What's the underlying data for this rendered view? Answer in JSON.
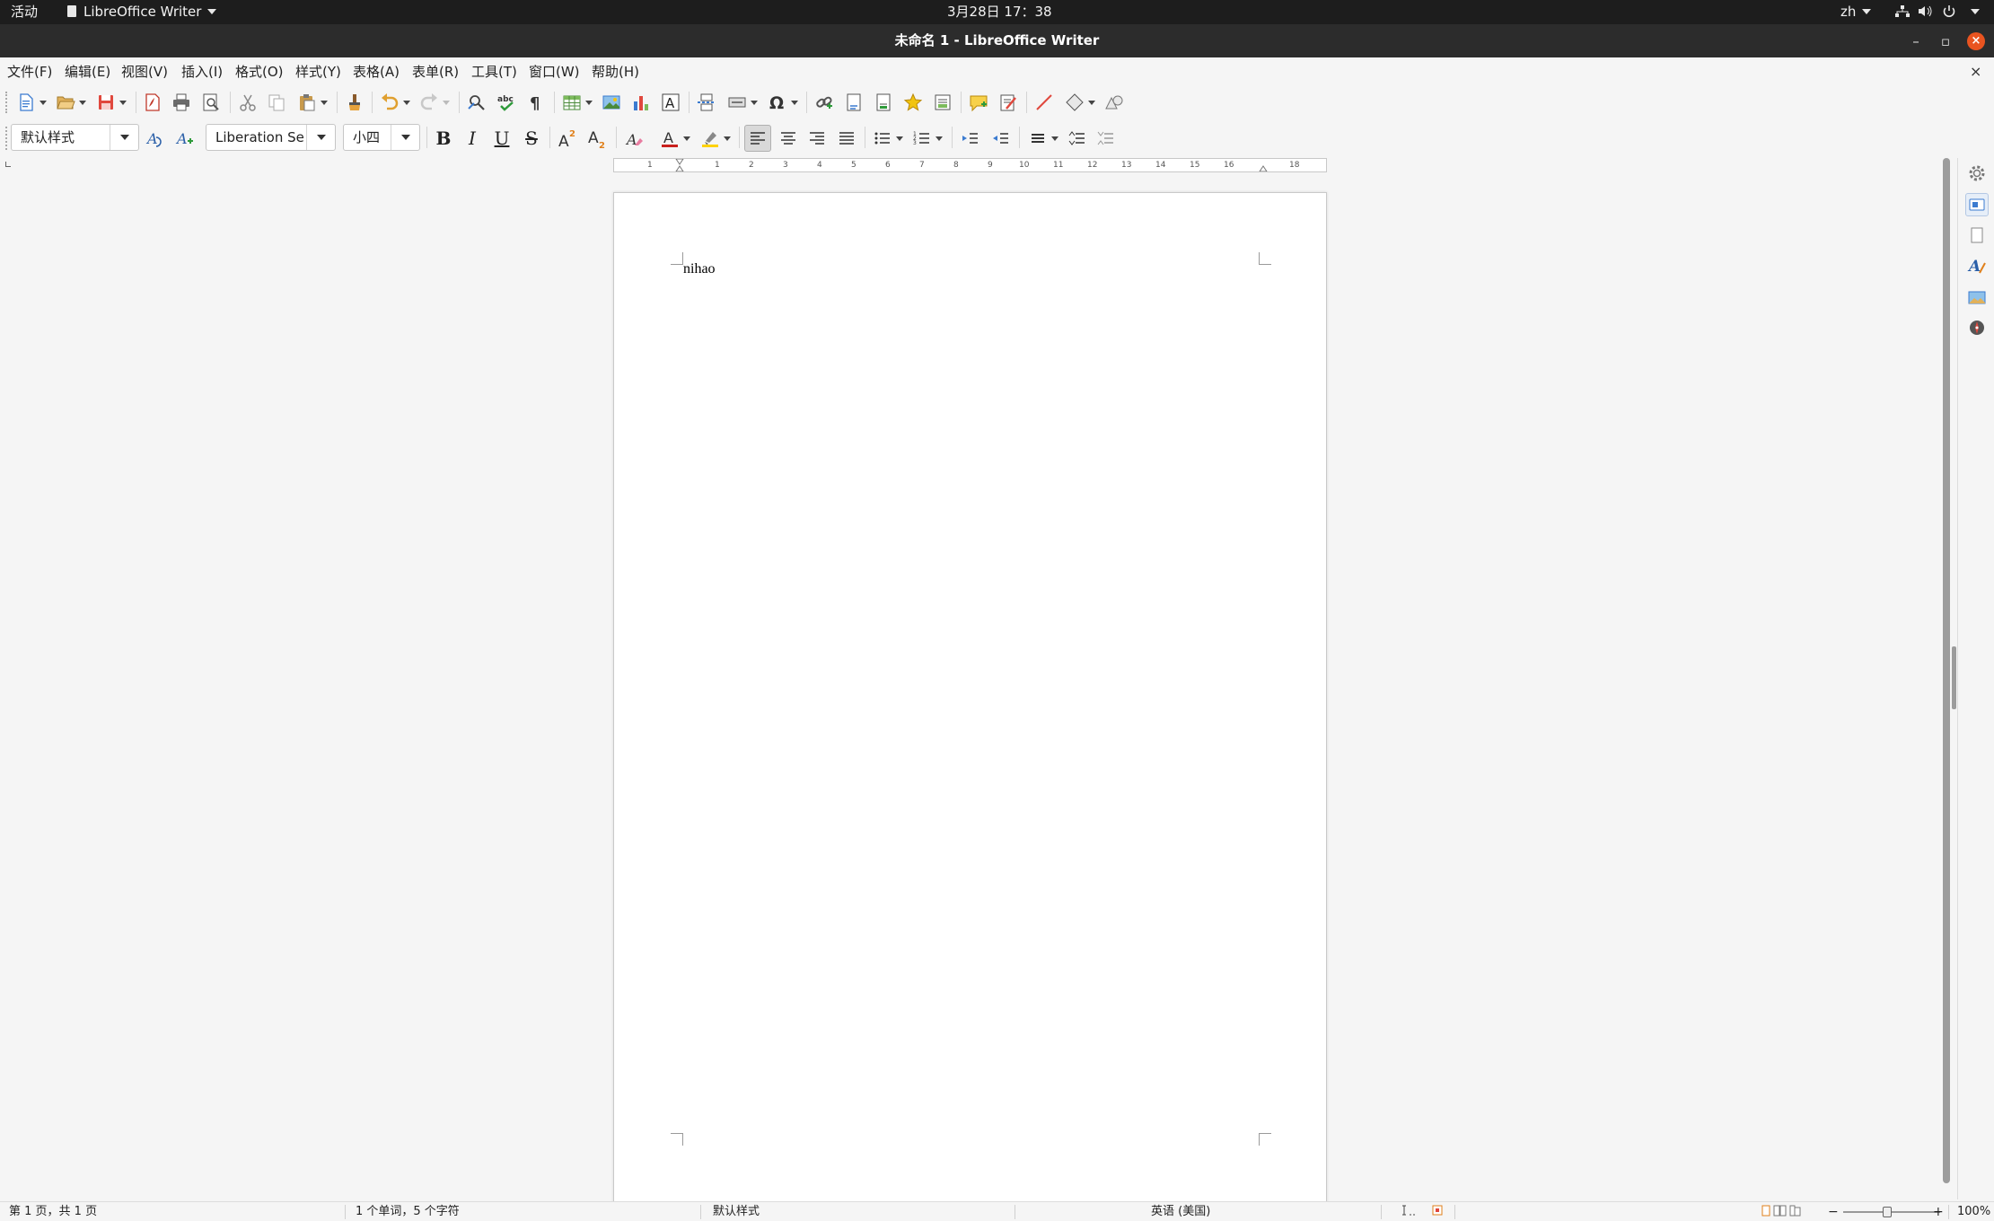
{
  "topbar": {
    "activities": "活动",
    "app_name": "LibreOffice Writer",
    "clock": "3月28日  17：38",
    "lang": "zh"
  },
  "window": {
    "title": "未命名 1 - LibreOffice Writer",
    "minimize": "–",
    "maximize": "▫",
    "close": "×"
  },
  "menubar": {
    "items": [
      "文件(F)",
      "编辑(E)",
      "视图(V)",
      "插入(I)",
      "格式(O)",
      "样式(Y)",
      "表格(A)",
      "表单(R)",
      "工具(T)",
      "窗口(W)",
      "帮助(H)"
    ],
    "doc_close": "×"
  },
  "toolbar2": {
    "paragraph_style": "默认样式",
    "font_name": "Liberation Se",
    "font_size": "小四",
    "bold": "B",
    "italic": "I",
    "underline": "U",
    "strike": "S"
  },
  "ruler": {
    "labels": [
      "1",
      "1",
      "2",
      "3",
      "4",
      "5",
      "6",
      "7",
      "8",
      "9",
      "10",
      "11",
      "12",
      "13",
      "14",
      "15",
      "16",
      "18"
    ]
  },
  "document": {
    "text": "nihao"
  },
  "statusbar": {
    "page": "第 1 页，共 1 页",
    "words": "1 个单词，5 个字符",
    "style": "默认样式",
    "language": "英语 (美国)",
    "zoom": "100%"
  },
  "colors": {
    "topbar": "#1d1d1d",
    "titlebar": "#2c2c2c",
    "close_button": "#e95420",
    "background": "#f5f5f5"
  }
}
